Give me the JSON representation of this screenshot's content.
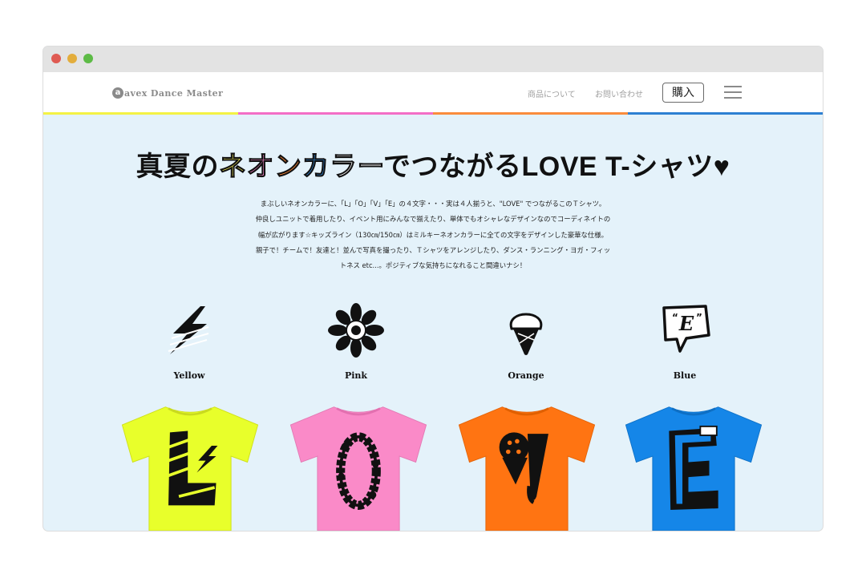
{
  "header": {
    "logo_mark": "a",
    "logo_text": "avex Dance Master",
    "nav": [
      "商品について",
      "お問い合わせ"
    ],
    "buy_label": "購入"
  },
  "colors": {
    "bar": [
      "#f4f244",
      "#f36ec6",
      "#fa8c3c",
      "#2d80d2"
    ],
    "page_bg": "#e4f2fa",
    "neon": [
      "#f6f05a",
      "#fd8bd0",
      "#fe8836",
      "#2e86d6",
      "#ffffff"
    ],
    "shirts": [
      "#e8ff2b",
      "#fa8ac8",
      "#ff7412",
      "#1586e8"
    ]
  },
  "headline": {
    "pre": "真夏の",
    "neon_chars": [
      "ネ",
      "オ",
      "ン",
      "カ",
      "ラ",
      "ー"
    ],
    "post": "でつながるLOVE T-シャツ♥"
  },
  "description": [
    "まぶしいネオンカラーに、「L」「O」「V」「E」の４文字・・・実は４人揃うと、\"LOVE\" でつながるこのＴシャツ。",
    "仲良しユニットで着用したり、イベント用にみんなで揃えたり、単体でもオシャレなデザインなのでコーディネイトの",
    "幅が広がります☆キッズライン（130㎝/150㎝）はミルキーネオンカラーに全ての文字をデザインした豪華な仕様。",
    "親子で！チームで！友達と！並んで写真を撮ったり、Ｔシャツをアレンジしたり、ダンス・ランニング・ヨガ・フィッ",
    "トネス etc...。ポジティブな気持ちになれること間違いナシ！"
  ],
  "products": [
    {
      "name": "Yellow",
      "icon": "lightning-icon",
      "letter": "L"
    },
    {
      "name": "Pink",
      "icon": "flower-icon",
      "letter": "O"
    },
    {
      "name": "Orange",
      "icon": "ice-cream-icon",
      "letter": "V"
    },
    {
      "name": "Blue",
      "icon": "speech-bubble-e-icon",
      "letter": "E"
    }
  ]
}
